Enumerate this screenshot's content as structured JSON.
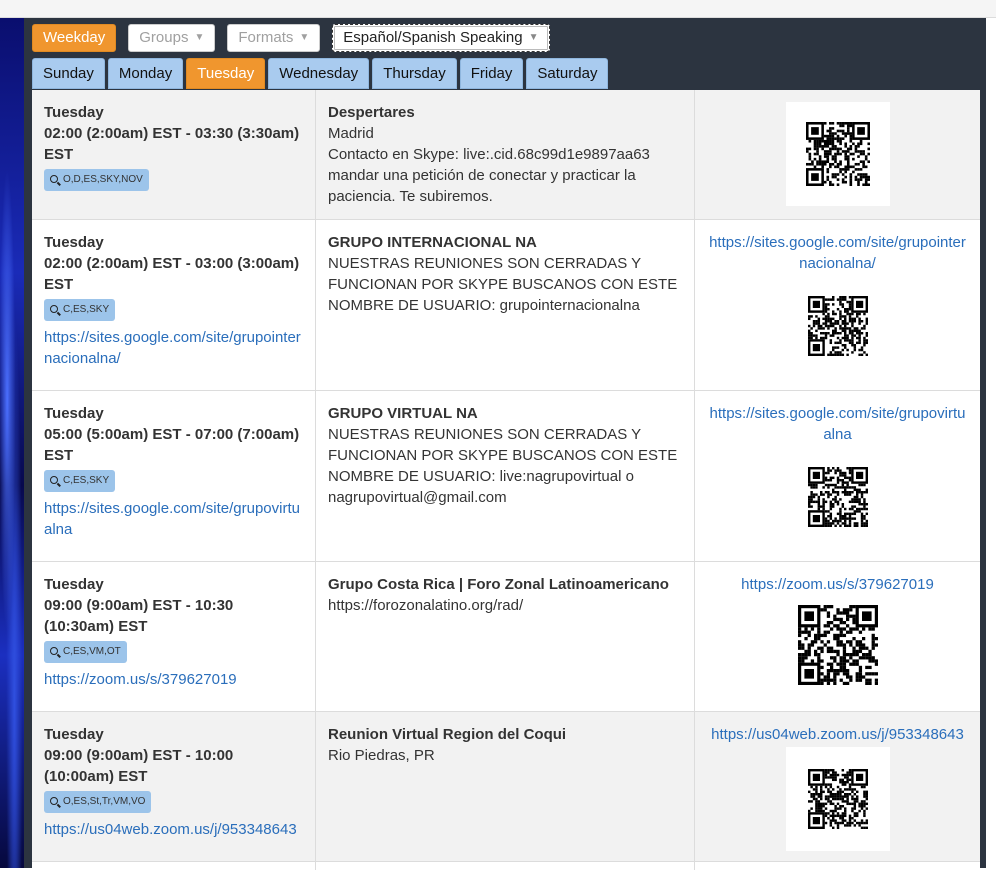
{
  "filters": {
    "weekday": "Weekday",
    "groups": "Groups",
    "formats": "Formats",
    "language": "Español/Spanish Speaking"
  },
  "tabs": [
    "Sunday",
    "Monday",
    "Tuesday",
    "Wednesday",
    "Thursday",
    "Friday",
    "Saturday"
  ],
  "active_tab": "Tuesday",
  "meetings": [
    {
      "day": "Tuesday",
      "time": "02:00 (2:00am) EST - 03:30 (3:30am) EST",
      "formats": "O,D,ES,SKY,NOV",
      "link": "",
      "name": "Despertares",
      "location": "Madrid",
      "notes": "Contacto en Skype: live:.cid.68c99d1e9897aa63 mandar una petición de conectar y practicar la paciencia. Te subiremos.",
      "qr_link": ""
    },
    {
      "day": "Tuesday",
      "time": "02:00 (2:00am) EST - 03:00 (3:00am) EST",
      "formats": "C,ES,SKY",
      "link": "https://sites.google.com/site/grupointernacionalna/",
      "name": "GRUPO INTERNACIONAL NA",
      "location": "",
      "notes": "NUESTRAS REUNIONES SON CERRADAS Y FUNCIONAN POR SKYPE BUSCANOS CON ESTE NOMBRE DE USUARIO: grupointernacionalna",
      "qr_link": "https://sites.google.com/site/grupointernacionalna/"
    },
    {
      "day": "Tuesday",
      "time": "05:00 (5:00am) EST - 07:00 (7:00am) EST",
      "formats": "C,ES,SKY",
      "link": "https://sites.google.com/site/grupovirtualna",
      "name": "GRUPO VIRTUAL NA",
      "location": "",
      "notes": "NUESTRAS REUNIONES SON CERRADAS Y FUNCIONAN POR SKYPE BUSCANOS CON ESTE NOMBRE DE USUARIO: live:nagrupovirtual o nagrupovirtual@gmail.com",
      "qr_link": "https://sites.google.com/site/grupovirtualna"
    },
    {
      "day": "Tuesday",
      "time": "09:00 (9:00am) EST - 10:30 (10:30am) EST",
      "formats": "C,ES,VM,OT",
      "link": "https://zoom.us/s/379627019",
      "name": "Grupo Costa Rica | Foro Zonal Latinoamericano",
      "location": "https://forozonalatino.org/rad/",
      "notes": "",
      "qr_link": "https://zoom.us/s/379627019"
    },
    {
      "day": "Tuesday",
      "time": "09:00 (9:00am) EST - 10:00 (10:00am) EST",
      "formats": "O,ES,St,Tr,VM,VO",
      "link": "https://us04web.zoom.us/j/953348643",
      "name": "Reunion Virtual Region del Coqui",
      "location": "Rio Piedras, PR",
      "notes": "",
      "qr_link": "https://us04web.zoom.us/j/953348643"
    }
  ]
}
